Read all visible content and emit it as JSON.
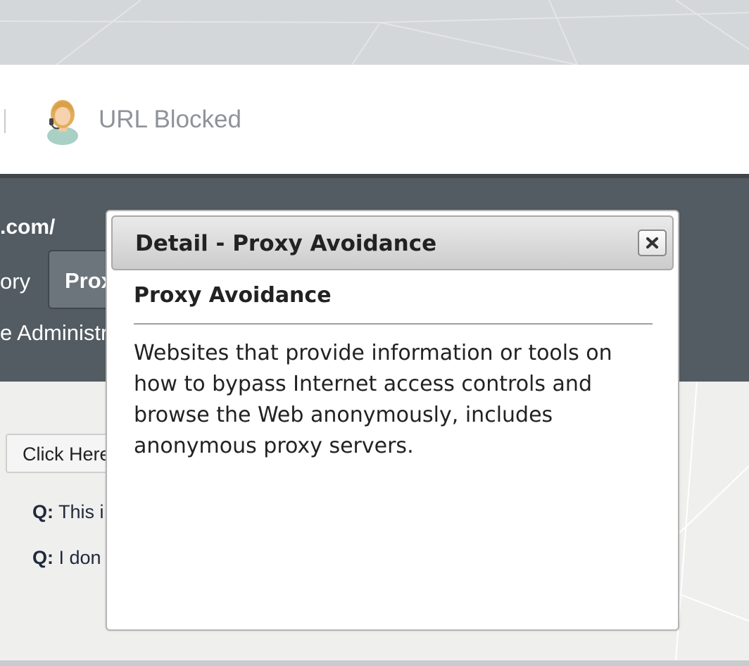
{
  "header": {
    "title": "URL Blocked",
    "avatar_icon": "support-agent-icon"
  },
  "info": {
    "url_fragment": ".com/",
    "tab_left_fragment": "ory",
    "active_tab_fragment": "Prox",
    "admin_fragment": "e Administra"
  },
  "content": {
    "click_button_label": "Click Here",
    "faq": [
      {
        "q_label": "Q:",
        "text": "This i"
      },
      {
        "q_label": "Q:",
        "text": "I don"
      }
    ]
  },
  "modal": {
    "title": "Detail - Proxy Avoidance",
    "close_icon": "close-icon",
    "heading": "Proxy Avoidance",
    "body": "Websites that provide information or tools on how to bypass Internet access controls and browse the Web anonymously, includes anonymous proxy servers."
  },
  "colors": {
    "band": "#535c62",
    "header_bg": "#ffffff",
    "content_bg": "#efefee",
    "modal_titlebar": "#d6d6d6"
  }
}
